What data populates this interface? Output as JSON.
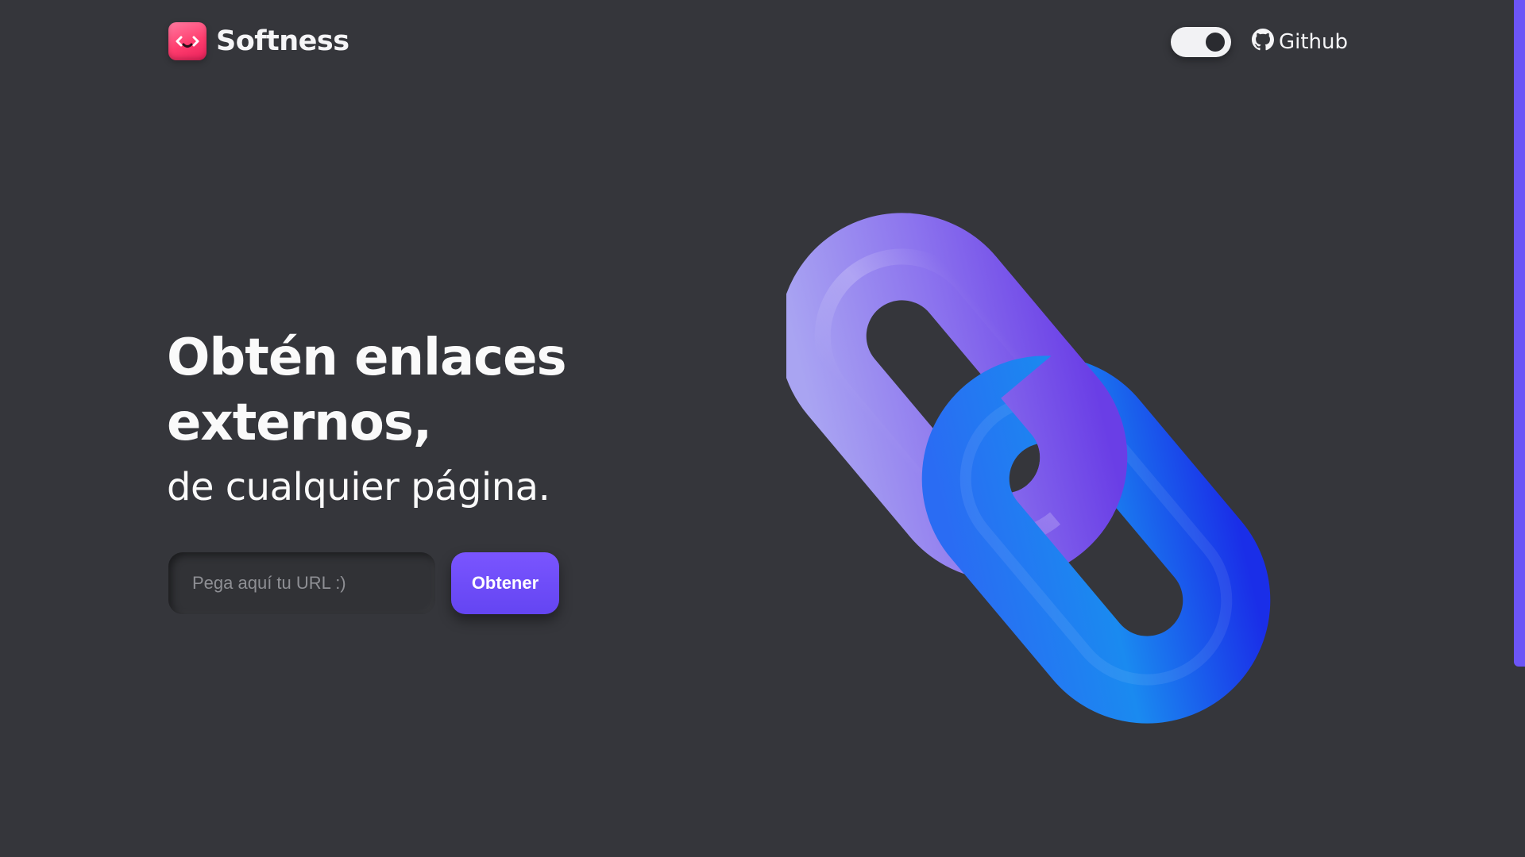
{
  "header": {
    "brand_name": "Softness",
    "github_label": "Github",
    "theme_toggle": "dark"
  },
  "hero": {
    "title_line1": "Obtén enlaces",
    "title_line2": "externos,",
    "subtitle": "de cualquier página."
  },
  "form": {
    "url_placeholder": "Pega aquí tu URL :)",
    "url_value": "",
    "submit_label": "Obtener"
  },
  "colors": {
    "background": "#35363b",
    "accent": "#6c55f7",
    "logo": "#ff4d7a",
    "chain_purple": "#8f7cf0",
    "chain_blue": "#1f6cf5"
  },
  "icons": {
    "logo": "code-smile-icon",
    "github": "github-icon",
    "illustration": "chain-link-illustration"
  }
}
